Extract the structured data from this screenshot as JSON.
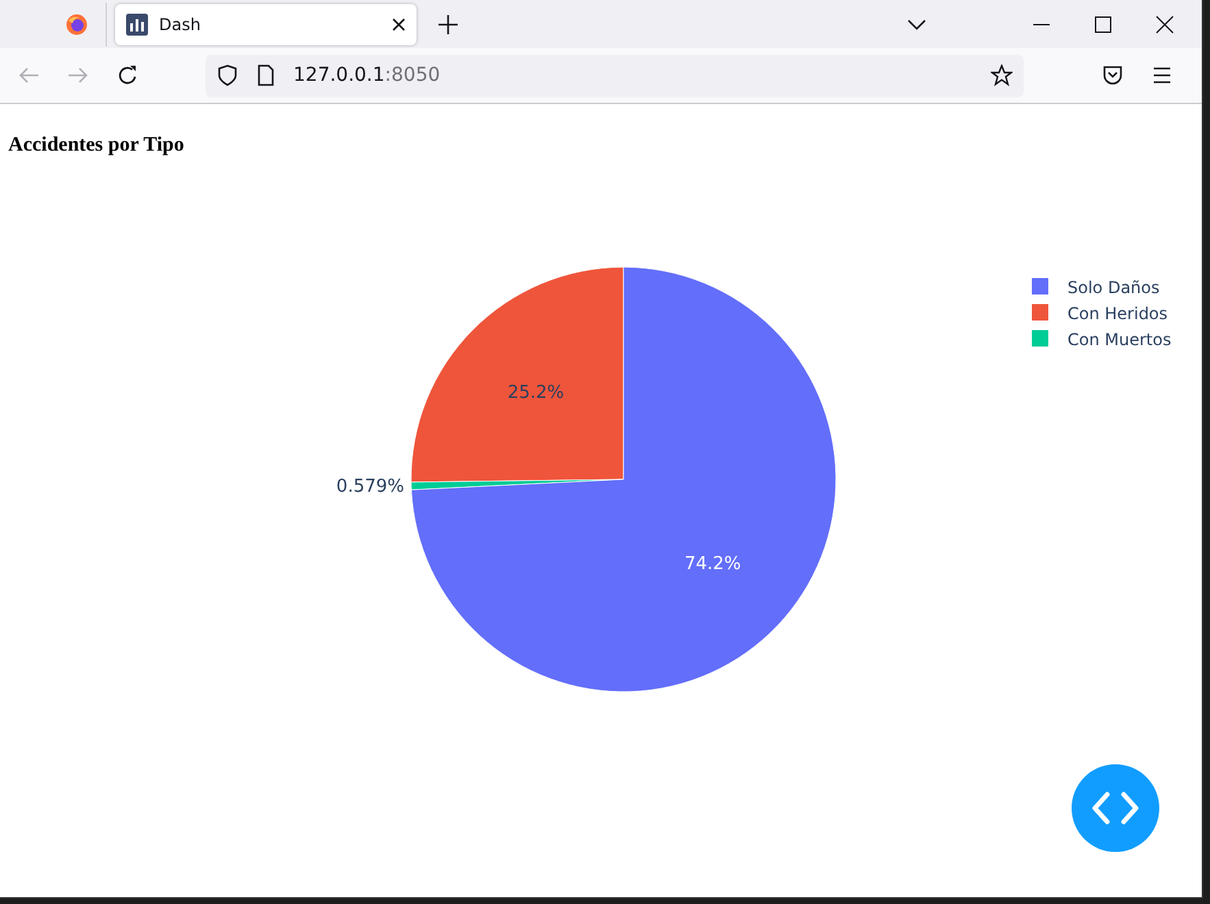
{
  "browser": {
    "tab": {
      "title": "Dash"
    },
    "address": {
      "host": "127.0.0.1",
      "port": ":8050"
    }
  },
  "page": {
    "title": "Accidentes por Tipo",
    "chart_data": {
      "type": "pie",
      "legend": "right",
      "categories": [
        "Solo Daños",
        "Con Heridos",
        "Con Muertos"
      ],
      "values": [
        74.2,
        25.2,
        0.579
      ],
      "colors": [
        "#636efa",
        "#ef553b",
        "#00cc96"
      ],
      "value_labels": [
        "74.2%",
        "25.2%",
        "0.579%"
      ]
    }
  }
}
